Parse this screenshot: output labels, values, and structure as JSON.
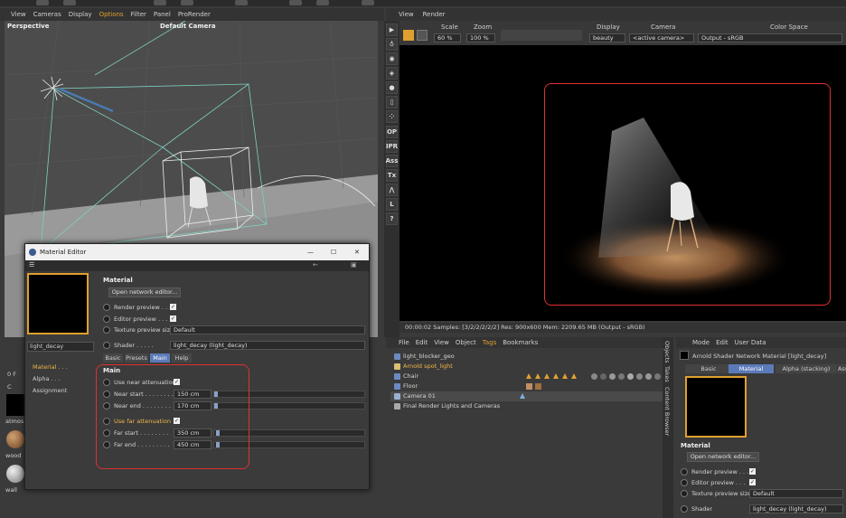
{
  "viewport": {
    "menu": [
      "View",
      "Cameras",
      "Display",
      "Options",
      "Filter",
      "Panel",
      "ProRender"
    ],
    "view_name": "Perspective",
    "camera_name": "Default Camera"
  },
  "palette": [
    "OP",
    "IPR",
    "Ass",
    "Tx",
    "L",
    "?"
  ],
  "render_view": {
    "menu": [
      "View",
      "Render"
    ],
    "scale_label": "Scale",
    "scale_value": "60 %",
    "zoom_label": "Zoom",
    "zoom_value": "100 %",
    "display_label": "Display",
    "display_value": "beauty",
    "camera_label": "Camera",
    "camera_value": "<active camera>",
    "colorspace_label": "Color Space",
    "colorspace_value": "Output - sRGB",
    "status": "00:00:02  Samples: [3/2/2/2/2/2]  Res: 900x600  Mem: 2209.65 MB  (Output - sRGB)"
  },
  "object_manager": {
    "menu": [
      "File",
      "Edit",
      "View",
      "Object",
      "Tags",
      "Bookmarks"
    ],
    "objects": [
      {
        "name": "light_blocker_geo"
      },
      {
        "name": "Arnold spot_light"
      },
      {
        "name": "Chair"
      },
      {
        "name": "Floor"
      },
      {
        "name": "Camera 01"
      },
      {
        "name": "Final Render Lights and Cameras"
      }
    ],
    "side_tabs": [
      "Objects",
      "Takes",
      "Content Browser"
    ]
  },
  "attribute_manager": {
    "menu": [
      "Mode",
      "Edit",
      "User Data"
    ],
    "title": "Arnold Shader Network Material [light_decay]",
    "tabs": [
      "Basic",
      "Material",
      "Alpha (stacking)",
      "Ass"
    ],
    "section": "Material",
    "open_button": "Open network editor...",
    "render_preview": "Render preview . . .",
    "editor_preview": "Editor preview . . .",
    "texture_preview_label": "Texture preview size",
    "texture_preview_value": "Default",
    "shader_label": "Shader",
    "shader_value": "light_decay (light_decay)"
  },
  "material_editor": {
    "title": "Material Editor",
    "material_name": "light_decay",
    "channels": [
      "Material . . .",
      "Alpha . . .",
      "Assignment"
    ],
    "section_material": "Material",
    "open_button": "Open network editor...",
    "render_preview": "Render preview . . .",
    "editor_preview": "Editor preview . . .",
    "texture_preview_label": "Texture preview size",
    "texture_preview_value": "Default",
    "shader_label": "Shader . . . . .",
    "shader_value": "light_decay (light_decay)",
    "tabs": [
      "Basic",
      "Presets",
      "Main",
      "Help"
    ],
    "section_main": "Main",
    "use_near_label": "Use near attenuation",
    "near_start_label": "Near start . . . . . . . .",
    "near_start_value": "150 cm",
    "near_end_label": "Near end . . . . . . . .",
    "near_end_value": "170 cm",
    "use_far_label": "Use far attenuation",
    "far_start_label": "Far start . . . . . . . .",
    "far_start_value": "350 cm",
    "far_end_label": "Far end . . . . . . . . .",
    "far_end_value": "450 cm"
  },
  "material_strip": {
    "labels": [
      "atmos",
      "wood",
      "wall",
      "0 F",
      "C"
    ]
  }
}
